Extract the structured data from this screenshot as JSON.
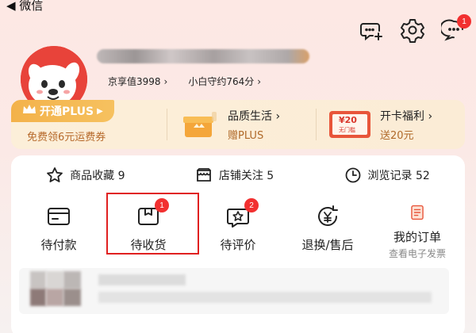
{
  "status": {
    "back_label": "◀ 微信"
  },
  "header": {
    "icons": [
      "add-friend-icon",
      "settings-icon",
      "message-icon"
    ],
    "message_badge": "1"
  },
  "user": {
    "jingxiang_label": "京享值3998",
    "xiaobai_label": "小白守约764分"
  },
  "plus": {
    "open_label": "开通PLUS",
    "open_sub": "免费领6元运费券",
    "items": [
      {
        "title": "品质生活",
        "desc": "赠PLUS"
      },
      {
        "title": "开卡福利",
        "desc": "送20元",
        "ticket_amount": "¥20",
        "ticket_note": "无门槛"
      }
    ]
  },
  "stats": [
    {
      "label": "商品收藏 9",
      "icon": "star-icon"
    },
    {
      "label": "店铺关注 5",
      "icon": "shop-icon"
    },
    {
      "label": "浏览记录 52",
      "icon": "clock-icon"
    }
  ],
  "orders": [
    {
      "label": "待付款",
      "icon": "wallet-icon"
    },
    {
      "label": "待收货",
      "icon": "package-icon",
      "badge": "1"
    },
    {
      "label": "待评价",
      "icon": "review-icon",
      "badge": "2"
    },
    {
      "label": "退换/售后",
      "icon": "refund-icon"
    },
    {
      "label": "我的订单",
      "icon": "order-list-icon",
      "sub": "查看电子发票"
    }
  ],
  "colors": {
    "accent": "#f23030",
    "plus_gold": "#f3b24a",
    "highlight": "#e02020"
  }
}
